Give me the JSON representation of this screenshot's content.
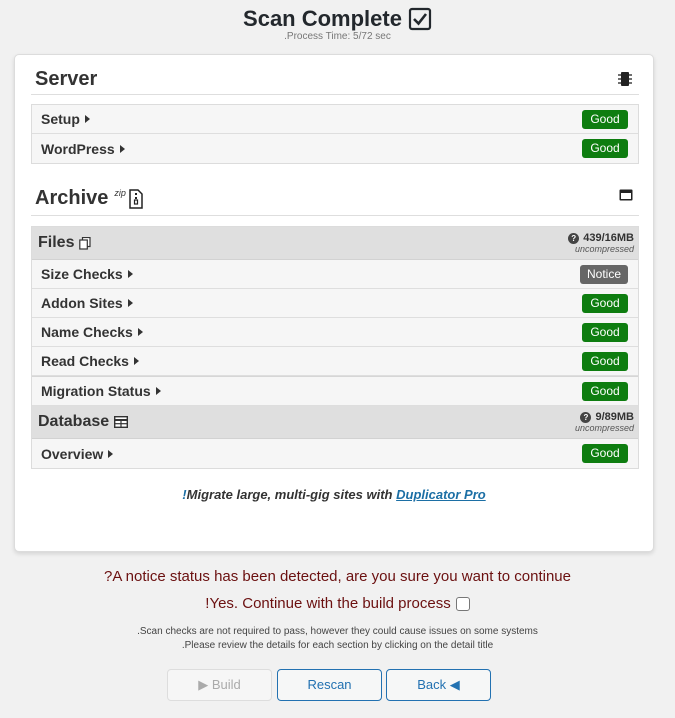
{
  "header": {
    "title": "Scan Complete",
    "process_time": ".Process Time: 5/72 sec"
  },
  "server": {
    "title": "Server",
    "rows": [
      {
        "label": "Setup",
        "status": "Good"
      },
      {
        "label": "WordPress",
        "status": "Good"
      }
    ]
  },
  "archive": {
    "title": "Archive",
    "superscript": "zip",
    "files": {
      "title": "Files",
      "size": "439/16MB",
      "note": "uncompressed",
      "rows": [
        {
          "label": "Size Checks",
          "status": "Notice"
        },
        {
          "label": "Addon Sites",
          "status": "Good"
        },
        {
          "label": "Name Checks",
          "status": "Good"
        },
        {
          "label": "Read Checks",
          "status": "Good"
        },
        {
          "label": "Migration Status",
          "status": "Good"
        }
      ]
    },
    "database": {
      "title": "Database",
      "size": "9/89MB",
      "note": "uncompressed",
      "rows": [
        {
          "label": "Overview",
          "status": "Good"
        }
      ]
    }
  },
  "promo": {
    "bang": "!",
    "text": "Migrate large, multi-gig sites with ",
    "link": "Duplicator Pro"
  },
  "notice_message": "?A notice status has been detected, are you sure you want to continue",
  "confirm_label": "!Yes. Continue with the build process",
  "notes": [
    ".Scan checks are not required to pass, however they could cause issues on some systems",
    ".Please review the details for each section by clicking on the detail title"
  ],
  "buttons": {
    "build": "▶ Build",
    "rescan": "Rescan",
    "back": "Back ◀"
  },
  "colors": {
    "good": "#0e7d10",
    "notice": "#666666",
    "link": "#1c6fa5",
    "warning_text": "#6b1010"
  }
}
